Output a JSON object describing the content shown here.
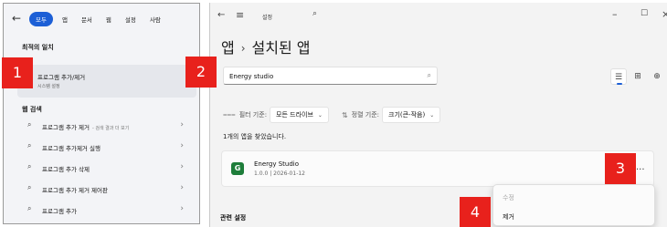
{
  "search_panel": {
    "filters": [
      "모두",
      "앱",
      "문서",
      "웹",
      "설정",
      "사람"
    ],
    "best_match_heading": "최적의 일치",
    "best_match": {
      "title": "프로그램 추가/제거",
      "subtitle": "시스템 설정"
    },
    "web_heading": "웹 검색",
    "web_results": [
      {
        "text": "프로그램 추가 제거",
        "extra": "- 검색 결과 더 보기"
      },
      {
        "text": "프로그램 추가제거 실행",
        "extra": ""
      },
      {
        "text": "프로그램 추가 삭제",
        "extra": ""
      },
      {
        "text": "프로그램 추가 제거 제어판",
        "extra": ""
      },
      {
        "text": "프로그램 추가",
        "extra": ""
      }
    ]
  },
  "settings": {
    "window_title": "설정",
    "breadcrumb": {
      "parent": "앱",
      "current": "설치된 앱"
    },
    "search_value": "Energy studio",
    "filter_label": "필터 기준:",
    "filter_value": "모든 드라이브",
    "sort_label": "정렬 기준:",
    "sort_value": "크기(큰-작음)",
    "found_text": "1개의 앱을 찾았습니다.",
    "app": {
      "name": "Energy Studio",
      "version": "1.0.0",
      "date": "2026-01-12",
      "icon_letter": "G"
    },
    "more_label": "...",
    "related_label": "관련 설정",
    "context_menu": {
      "modify": "수정",
      "uninstall": "제거"
    }
  },
  "callouts": [
    "1",
    "2",
    "3",
    "4"
  ],
  "colors": {
    "accent": "#1c5fd6",
    "callout": "#e8211c",
    "app_icon": "#1e7d3a"
  }
}
